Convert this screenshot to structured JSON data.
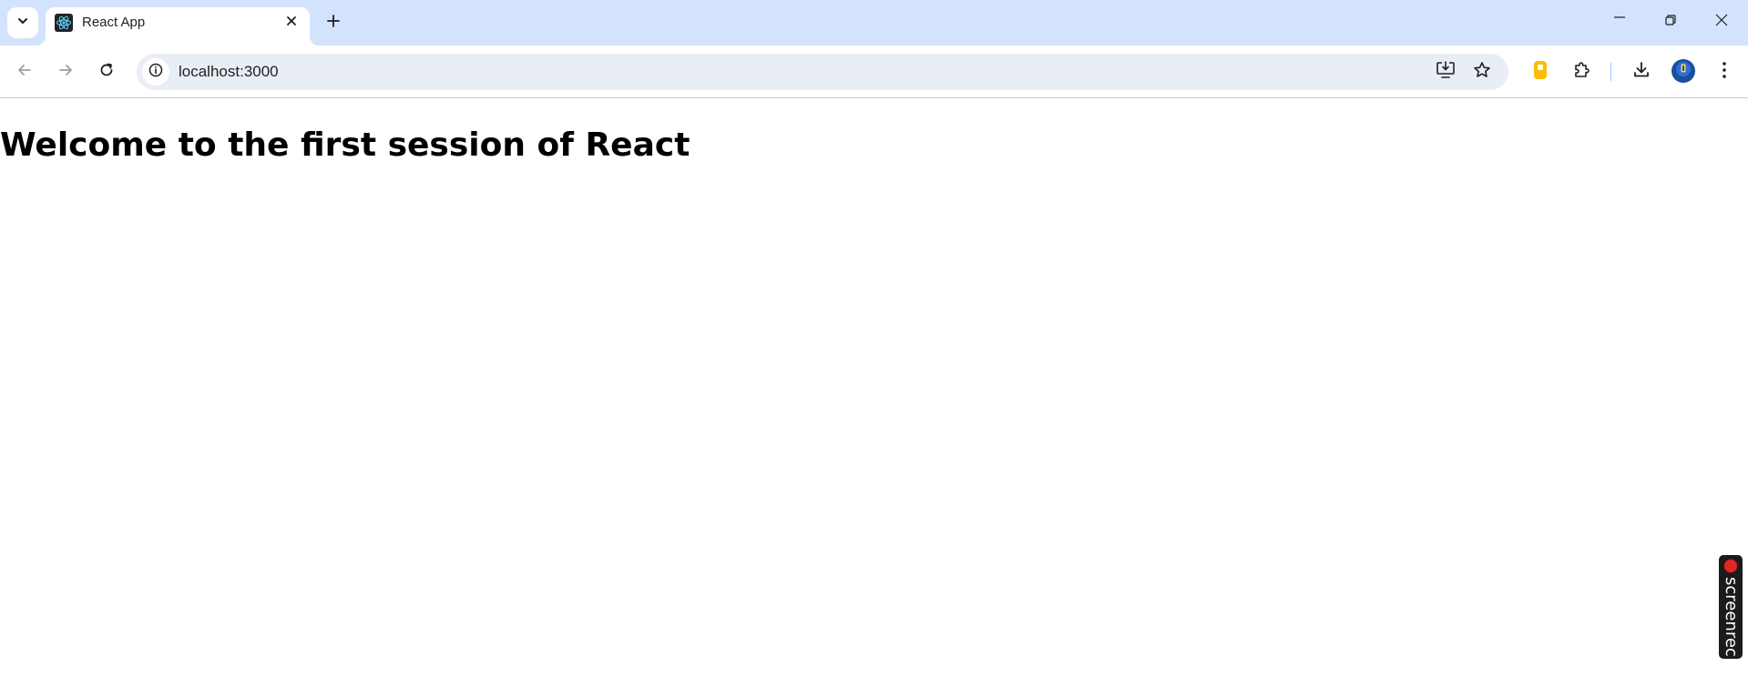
{
  "browser": {
    "tab": {
      "title": "React App",
      "favicon": "react-logo-icon"
    },
    "address_bar": {
      "url": "localhost:3000"
    },
    "icons": {
      "tab_search": "chevron-down-icon",
      "tab_close": "close-icon",
      "new_tab": "plus-icon",
      "minimize": "minimize-icon",
      "restore": "restore-icon",
      "close_window": "close-icon",
      "back": "arrow-left-icon",
      "forward": "arrow-right-icon",
      "reload": "reload-icon",
      "site_info": "info-icon",
      "install_app": "install-app-icon",
      "bookmark": "star-icon",
      "extension_pinned": "extension-yellow-icon",
      "extensions": "puzzle-icon",
      "downloads": "download-icon",
      "profile": "avatar-icon",
      "menu": "kebab-menu-icon"
    },
    "colors": {
      "tabstrip_bg": "#d3e3fd",
      "omnibox_bg": "#e9eef6",
      "react_cyan": "#61dafb"
    }
  },
  "page": {
    "heading": "Welcome to the first session of React"
  },
  "overlay": {
    "screenrec_label": "screenrec",
    "record_color": "#e32626"
  }
}
